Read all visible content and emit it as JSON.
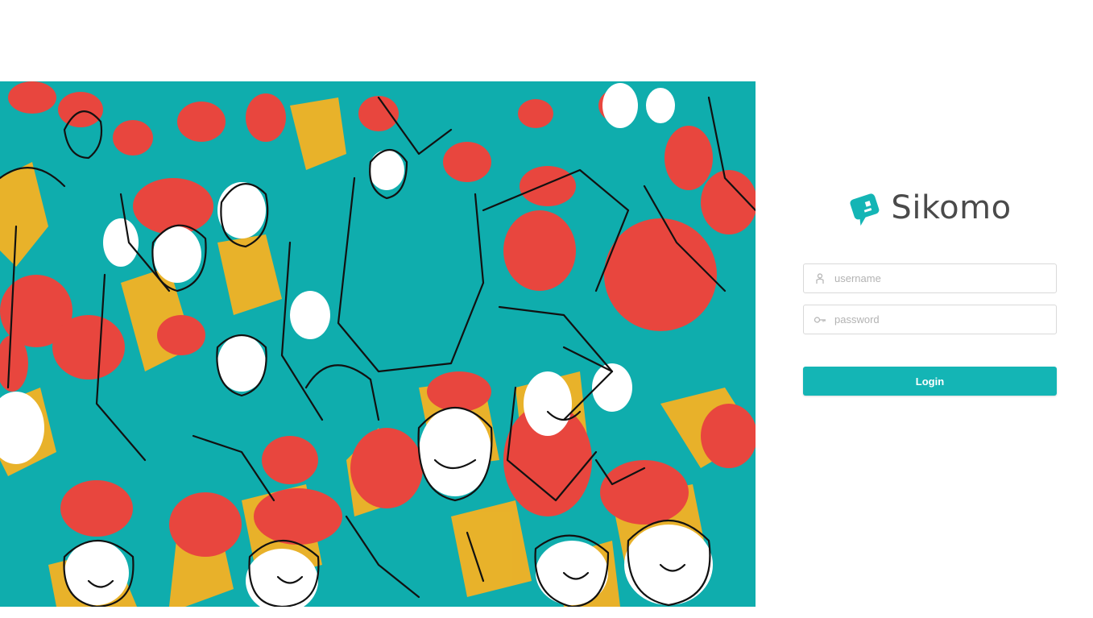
{
  "brand": {
    "name": "Sikomo",
    "logo_icon": "speech-bubble-face-icon",
    "accent_color": "#14b5b5"
  },
  "illustration": {
    "icon": "crowd-illustration",
    "colors": [
      "#0fadad",
      "#e8463e",
      "#f4b223",
      "#111111",
      "#ffffff"
    ]
  },
  "login_form": {
    "username": {
      "placeholder": "username",
      "value": "",
      "icon": "user-icon"
    },
    "password": {
      "placeholder": "password",
      "value": "",
      "icon": "key-icon"
    },
    "submit_label": "Login"
  }
}
